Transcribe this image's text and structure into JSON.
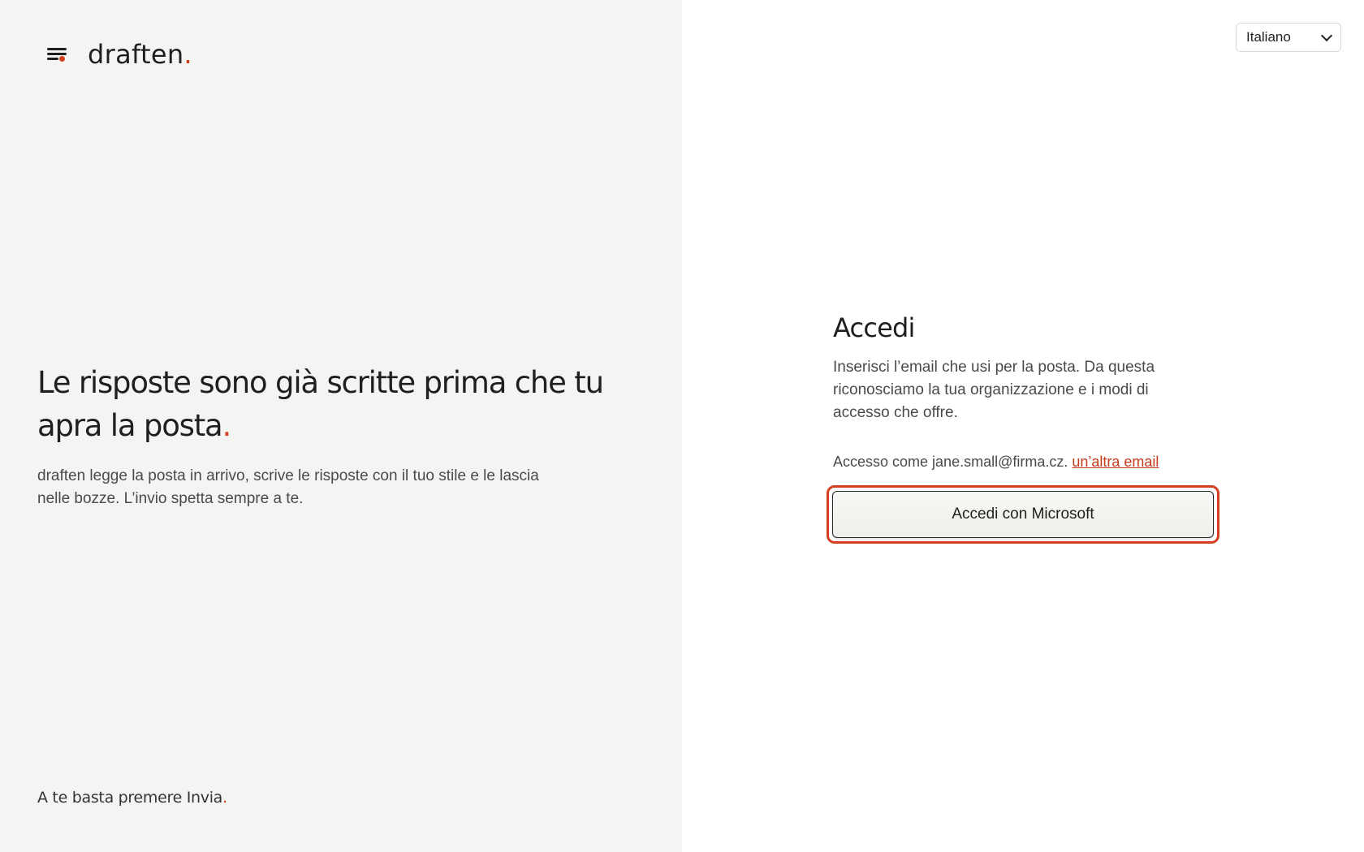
{
  "brand": {
    "name": "draften",
    "dot": ".",
    "accent_color": "#d2401f"
  },
  "hero": {
    "title_main": "Le risposte sono già scritte prima che tu apra la posta",
    "title_dot": ".",
    "subtitle": "draften legge la posta in arrivo, scrive le risposte con il tuo stile e le lascia nelle bozze. L’invio spetta sempre a te."
  },
  "tagline": {
    "text": "A te basta premere Invia",
    "dot": "."
  },
  "language": {
    "selected": "Italiano"
  },
  "signin": {
    "title": "Accedi",
    "description": "Inserisci l’email che usi per la posta. Da questa riconosciamo la tua organizzazione e i modi di accesso che offre.",
    "account_prefix": "Accesso come jane.small@firma.cz.",
    "other_email_link": "un’altra email",
    "microsoft_button": "Accedi con Microsoft"
  },
  "icons": {
    "logo": "menu-lines-icon",
    "dropdown": "chevron-down-icon"
  }
}
